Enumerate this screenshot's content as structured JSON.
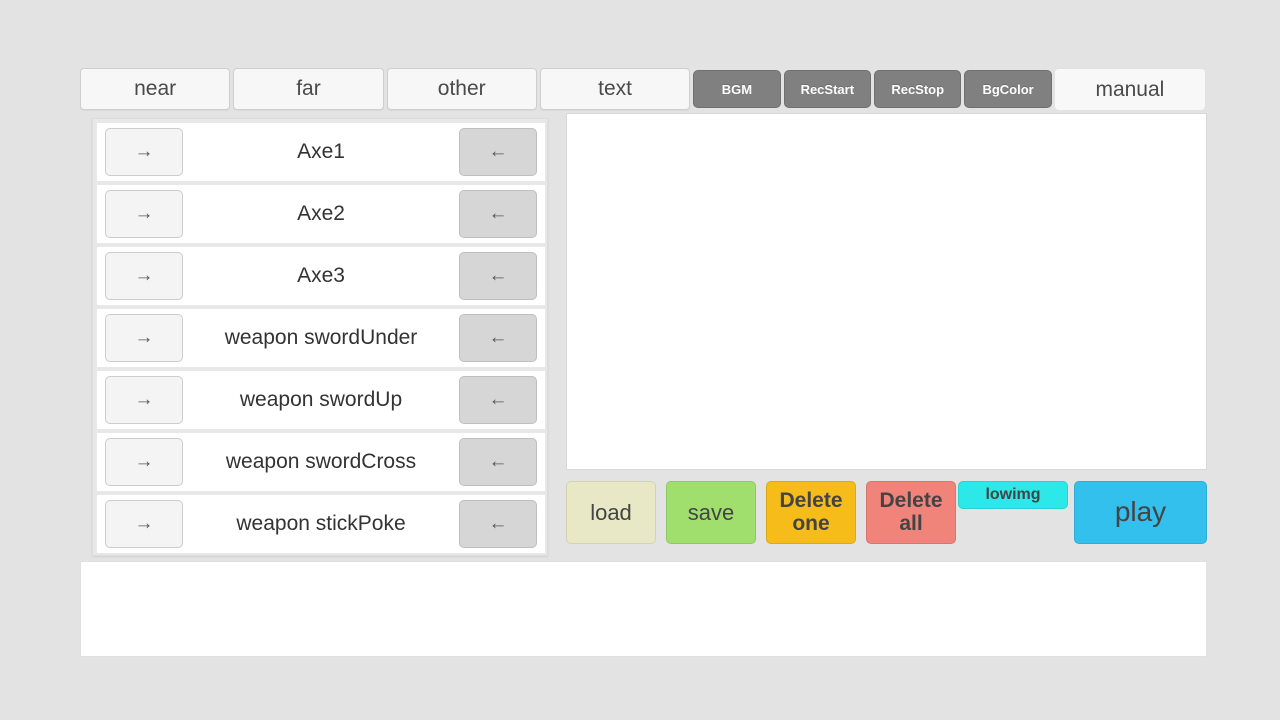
{
  "tabs": [
    {
      "label": "near",
      "style": "wide",
      "active": false
    },
    {
      "label": "far",
      "style": "wide",
      "active": false
    },
    {
      "label": "other",
      "style": "wide",
      "active": false
    },
    {
      "label": "text",
      "style": "wide",
      "active": false
    },
    {
      "label": "BGM",
      "style": "gray",
      "active": false
    },
    {
      "label": "RecStart",
      "style": "gray",
      "active": false
    },
    {
      "label": "RecStop",
      "style": "gray",
      "active": false
    },
    {
      "label": "BgColor",
      "style": "gray",
      "active": false
    },
    {
      "label": "manual",
      "style": "wide",
      "active": true
    }
  ],
  "list": {
    "left_arrow_icon": "arrow-right-icon",
    "right_arrow_icon": "arrow-left-icon",
    "left_arrow_glyph": "→",
    "right_arrow_glyph": "←",
    "rows": [
      {
        "label": "Axe1"
      },
      {
        "label": "Axe2"
      },
      {
        "label": "Axe3"
      },
      {
        "label": "weapon swordUnder"
      },
      {
        "label": "weapon swordUp"
      },
      {
        "label": "weapon swordCross"
      },
      {
        "label": "weapon stickPoke"
      }
    ]
  },
  "canvas": {
    "content": ""
  },
  "actions": {
    "load": "load",
    "save": "save",
    "delete_one": "Delete\none",
    "delete_one_line1": "Delete",
    "delete_one_line2": "one",
    "delete_all_line1": "Delete",
    "delete_all_line2": "all",
    "lowimg": "lowimg",
    "play": "play"
  },
  "colors": {
    "background": "#e3e3e3",
    "tab_gray": "#808080",
    "load": "#e8e8c6",
    "save": "#a0de6e",
    "delete_one": "#f5bc1a",
    "delete_all": "#f0837a",
    "lowimg": "#2ce8e8",
    "play": "#33c0ec",
    "row_right_button": "#d6d6d6"
  },
  "bottom_panel": {
    "content": ""
  }
}
